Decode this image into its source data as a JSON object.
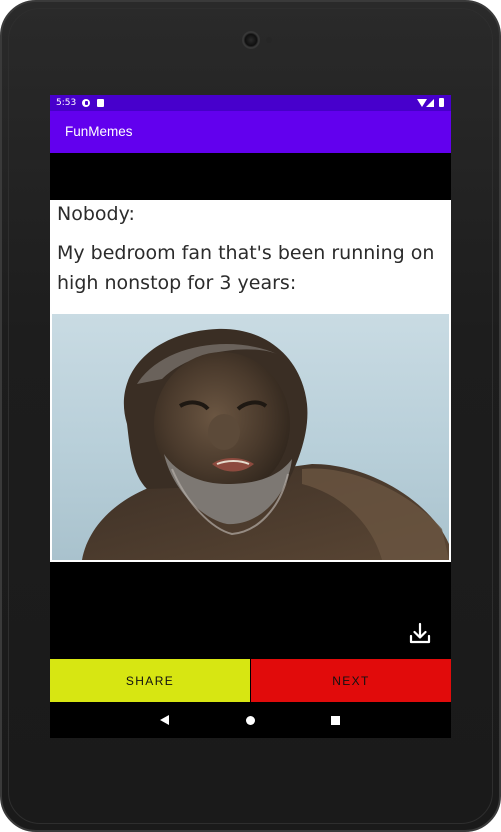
{
  "status_bar": {
    "time": "5:53",
    "background": "#4700cc"
  },
  "app_bar": {
    "title": "FunMemes",
    "background": "#6200ee"
  },
  "meme": {
    "line1": "Nobody:",
    "line2": "My bedroom fan that's been running on high nonstop for 3 years:"
  },
  "actions": {
    "download_icon": "download-icon",
    "share_label": "SHARE",
    "share_color": "#d7e612",
    "next_label": "NEXT",
    "next_color": "#e10b0b"
  },
  "nav_bar": {
    "back_icon": "back-triangle-icon",
    "home_icon": "home-circle-icon",
    "recents_icon": "recents-square-icon"
  }
}
